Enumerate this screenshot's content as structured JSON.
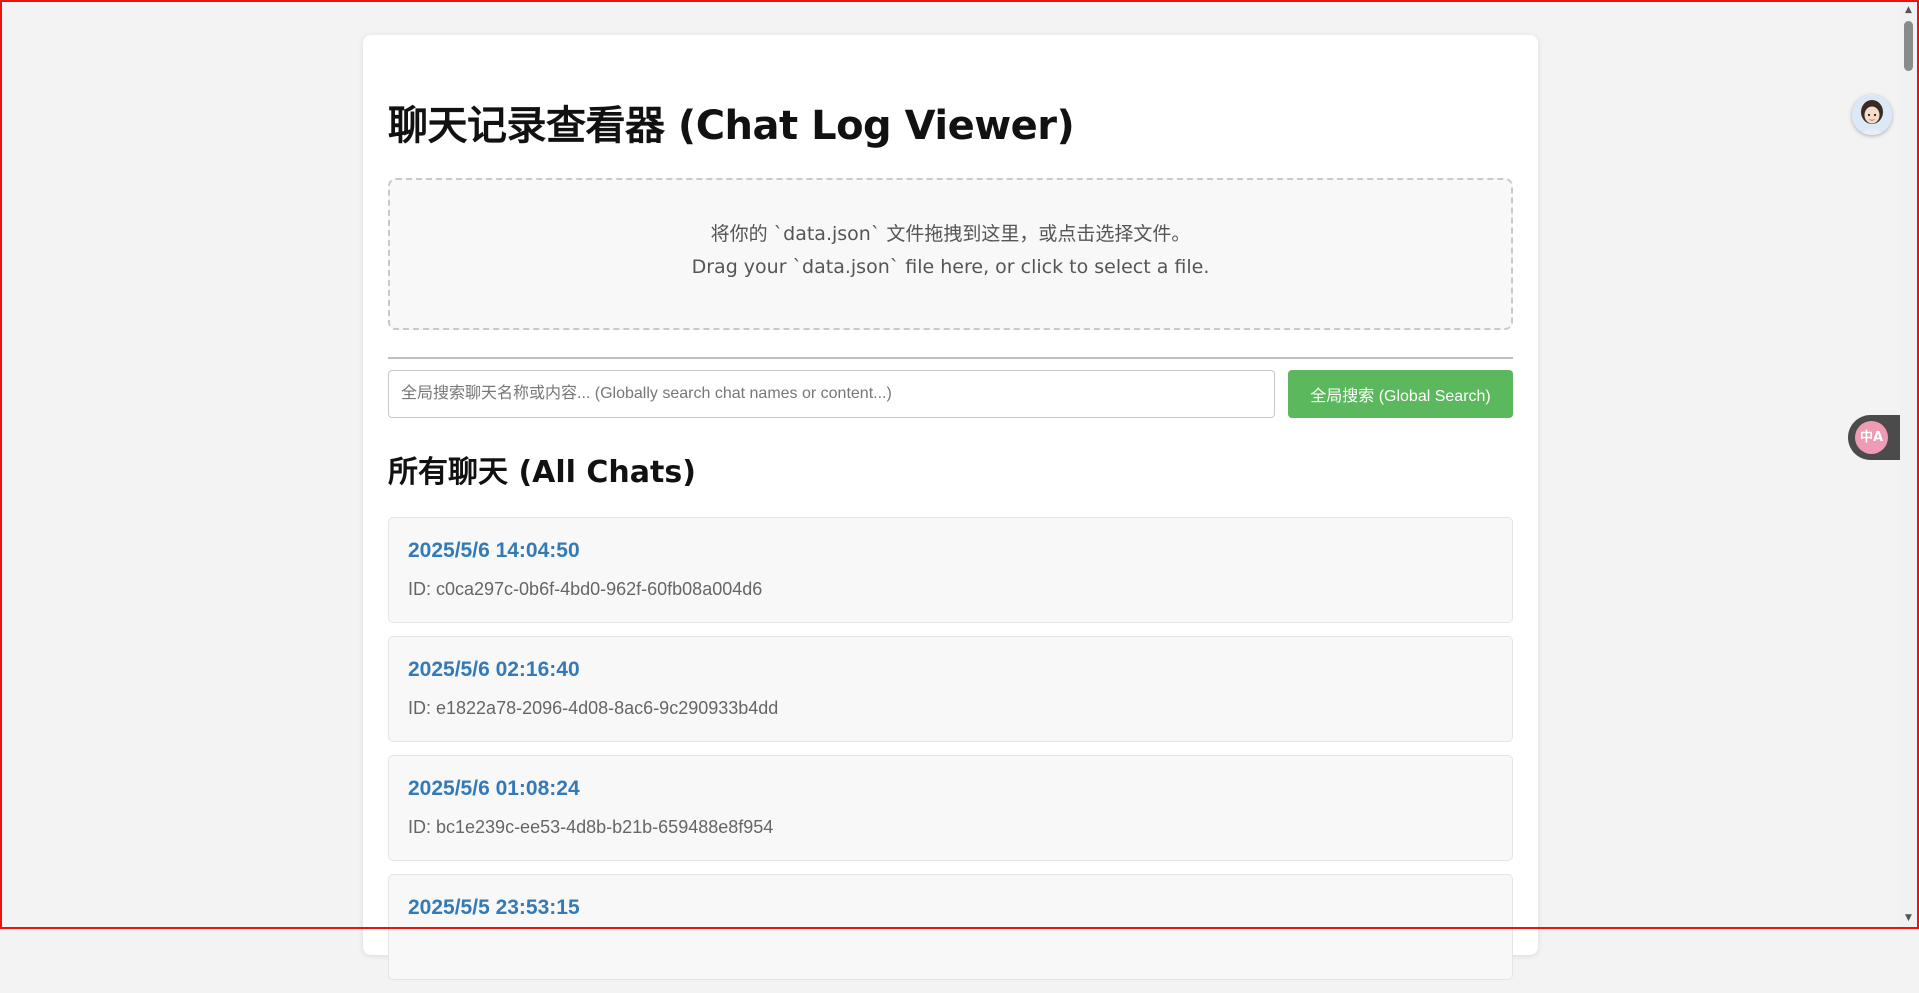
{
  "page": {
    "title": "聊天记录查看器 (Chat Log Viewer)"
  },
  "dropzone": {
    "line1": "将你的 `data.json` 文件拖拽到这里，或点击选择文件。",
    "line2": "Drag your `data.json` file here, or click to select a file."
  },
  "search": {
    "placeholder": "全局搜索聊天名称或内容... (Globally search chat names or content...)",
    "value": "",
    "button_label": "全局搜索 (Global Search)"
  },
  "chats": {
    "heading": "所有聊天 (All Chats)",
    "items": [
      {
        "title": "2025/5/6 14:04:50",
        "id": "ID: c0ca297c-0b6f-4bd0-962f-60fb08a004d6"
      },
      {
        "title": "2025/5/6 02:16:40",
        "id": "ID: e1822a78-2096-4d08-8ac6-9c290933b4dd"
      },
      {
        "title": "2025/5/6 01:08:24",
        "id": "ID: bc1e239c-ee53-4d8b-b21b-659488e8f954"
      },
      {
        "title": "2025/5/5 23:53:15",
        "id": ""
      }
    ]
  },
  "extension": {
    "translate_glyph": "中A"
  },
  "colors": {
    "accent_button": "#5cb85c",
    "chat_title": "#337ab7",
    "frame_border": "#ee1111"
  },
  "icons": {
    "avatar": "avatar-icon",
    "translate": "translate-icon",
    "scroll_up": "scroll-up-arrow-icon",
    "scroll_down": "scroll-down-arrow-icon"
  }
}
